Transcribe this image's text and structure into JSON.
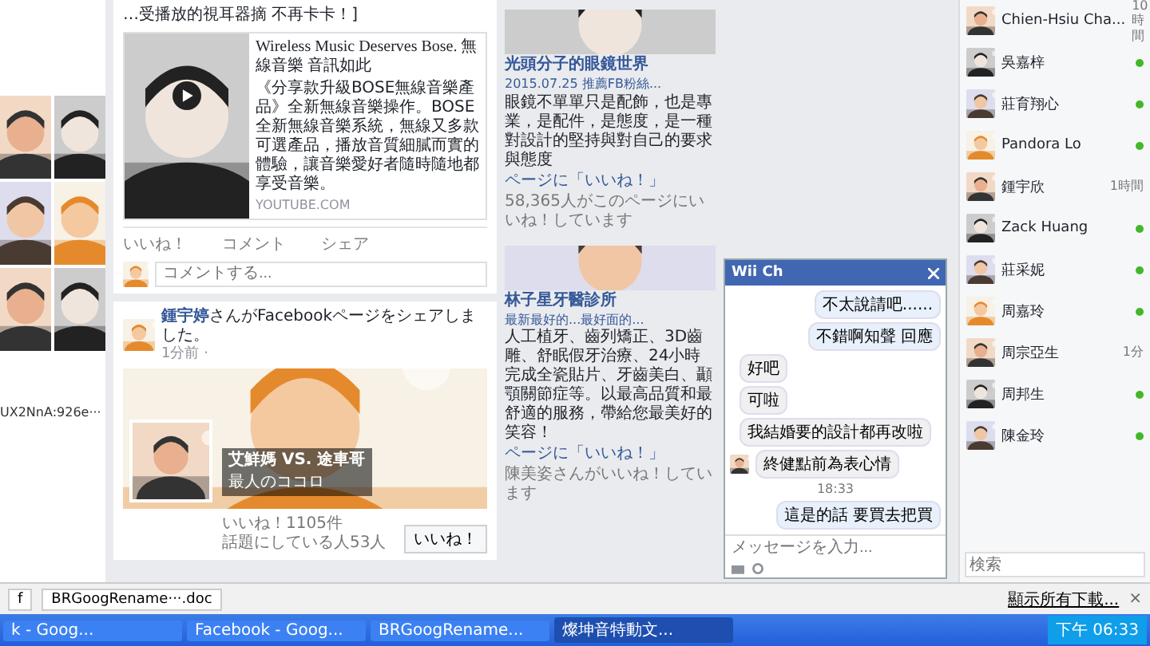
{
  "left_photos": {
    "caption": "UX2NnA:926e···"
  },
  "feed": {
    "posts": [
      {
        "kind": "link",
        "text": "…受播放的視耳器摘 不再卡卡！]",
        "card": {
          "title": "Wireless Music Deserves Bose. 無線音樂 音訊如此",
          "description": "《分享款升級BOSE無線音樂產品》全新無線音樂操作。BOSE全新無線音樂系統，無線又多款可選產品，播放音質細膩而實的體驗，讓音樂愛好者隨時隨地都享受音樂。",
          "source": "YOUTUBE.COM"
        },
        "actions": [
          "いいね！",
          "コメント",
          "シェア"
        ],
        "comment_placeholder": "コメントする..."
      },
      {
        "kind": "share",
        "author": "鍾宇婷",
        "text": "さんがFacebookページをシェアしました。",
        "time": "1分前 · ",
        "page": {
          "name": "艾鮮媽 VS. 途車哥",
          "category": "最人のココロ",
          "likes": "いいね！1105件",
          "talking": "話題にしている人53人",
          "button": "いいね！"
        }
      }
    ]
  },
  "ads": [
    {
      "title": "光頭分子的眼鏡世界",
      "subtitle": "2015.07.25 推薦FB粉絲...",
      "body": "眼鏡不單單只是配飾，也是專業，是配件，是態度，是一種對設計的堅持與對自己的要求與態度",
      "like_link": "ページに「いいね！」",
      "social": "58,365人がこのページにいいね！しています"
    },
    {
      "title": "林子星牙醫診所",
      "subtitle": "最新最好的...最好面的...",
      "body": "人工植牙、齒列矯正、3D齒雕、舒眠假牙治療、24小時完成全瓷貼片、牙齒美白、顳顎關節症等。以最高品質和最舒適的服務，帶給您最美好的笑容！",
      "like_link": "ページに「いいね！」",
      "social": "陳美姿さんがいいね！しています"
    }
  ],
  "chat": {
    "title": "Wii Ch",
    "messages": [
      {
        "kind": "out",
        "text": "不太說請吧......"
      },
      {
        "kind": "out",
        "text": "不錯啊知聲 回應"
      },
      {
        "kind": "in",
        "text": "好吧",
        "avatar": false
      },
      {
        "kind": "in",
        "text": "可啦",
        "avatar": false
      },
      {
        "kind": "in",
        "text": "我結婚要的設計都再改啦",
        "avatar": false
      },
      {
        "kind": "in",
        "text": "終健點前為表心情",
        "avatar": true
      },
      {
        "kind": "time",
        "text": "18:33"
      },
      {
        "kind": "out",
        "text": "這是的話 要買去把買"
      }
    ],
    "placeholder": "メッセージを入力..."
  },
  "contacts": {
    "items": [
      {
        "name": "Chien-Hsiu Cha...",
        "online": false,
        "time": "10時間"
      },
      {
        "name": "吳嘉梓",
        "online": true
      },
      {
        "name": "莊育翔心",
        "online": true
      },
      {
        "name": "Pandora Lo",
        "online": true
      },
      {
        "name": "鍾宇欣",
        "online": false,
        "time": "1時間"
      },
      {
        "name": "Zack Huang",
        "online": true
      },
      {
        "name": "莊采妮",
        "online": true
      },
      {
        "name": "周嘉玲",
        "online": true
      },
      {
        "name": "周宗亞生",
        "online": false,
        "time": "1分"
      },
      {
        "name": "周邦生",
        "online": true
      },
      {
        "name": "陳金玲",
        "online": true
      }
    ],
    "search_placeholder": "検索"
  },
  "downloads": {
    "items": [
      "f",
      "BRGoogRename···.doc"
    ],
    "show_all": "顯示所有下載...",
    "close": "×"
  },
  "taskbar": {
    "items": [
      {
        "label": "k - Goog...",
        "selected": false
      },
      {
        "label": "Facebook - Goog...",
        "selected": false
      },
      {
        "label": "BRGoogRename...",
        "selected": false
      },
      {
        "label": "燦坤音特動文...",
        "selected": true
      }
    ],
    "clock": "下午 06:33"
  }
}
